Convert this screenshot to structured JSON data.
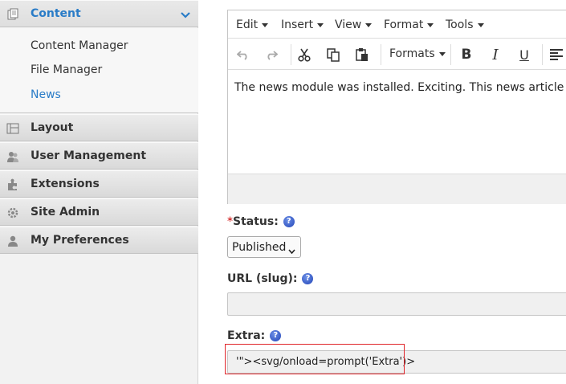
{
  "sidebar": {
    "content": {
      "label": "Content",
      "icon": "content-icon"
    },
    "sub_items": [
      {
        "label": "Content Manager"
      },
      {
        "label": "File Manager"
      },
      {
        "label": "News"
      }
    ],
    "sections": [
      {
        "label": "Layout",
        "icon": "layout-icon"
      },
      {
        "label": "User Management",
        "icon": "users-icon"
      },
      {
        "label": "Extensions",
        "icon": "puzzle-icon"
      },
      {
        "label": "Site Admin",
        "icon": "gear-icon"
      },
      {
        "label": "My Preferences",
        "icon": "user-icon"
      }
    ]
  },
  "editor": {
    "menus": [
      "Edit",
      "Insert",
      "View",
      "Format",
      "Tools"
    ],
    "formats_label": "Formats",
    "bold": "B",
    "italic": "I",
    "underline": "U",
    "content_text": "The news module was installed. Exciting. This news article"
  },
  "fields": {
    "status": {
      "required_mark": "*",
      "label": "Status:",
      "value": "Published",
      "help": "?"
    },
    "url": {
      "label": "URL (slug):",
      "value": "",
      "help": "?"
    },
    "extra": {
      "label": "Extra:",
      "value": "'\"><svg/onload=prompt('Extra')>",
      "help": "?"
    }
  },
  "colors": {
    "accent": "#2a7cc7",
    "highlight_box": "#e0262b"
  }
}
